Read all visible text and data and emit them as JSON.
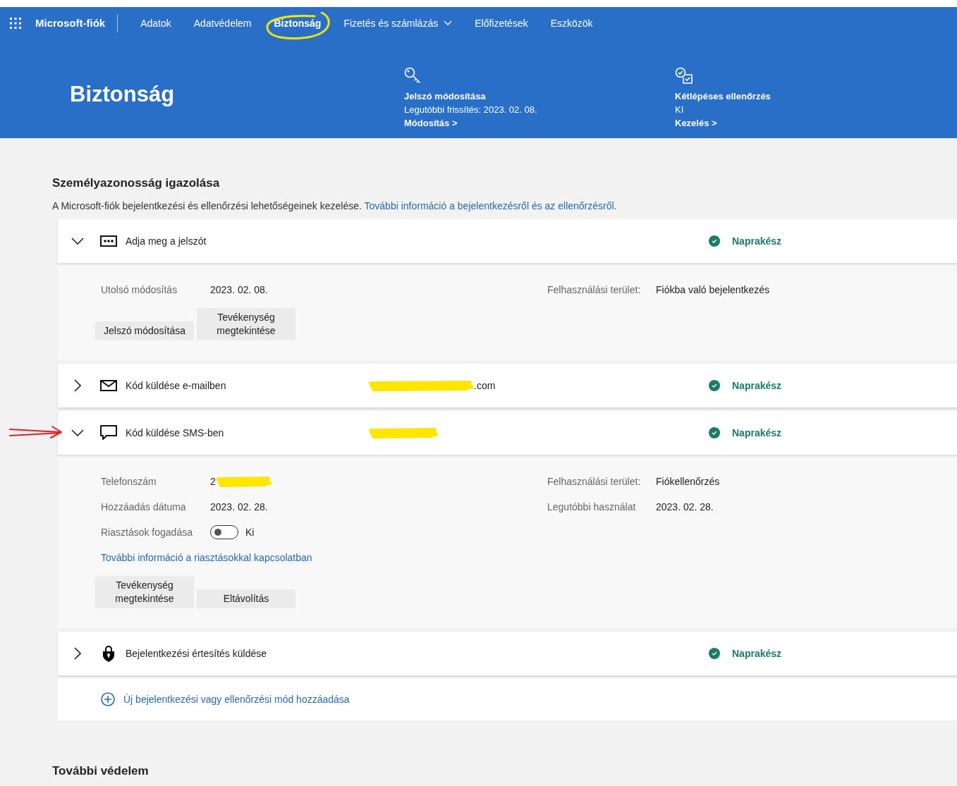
{
  "nav": {
    "brand": "Microsoft-fiók",
    "items": [
      {
        "label": "Adatok",
        "selected": false,
        "dropdown": false,
        "circled": false
      },
      {
        "label": "Adatvédelem",
        "selected": false,
        "dropdown": false,
        "circled": false
      },
      {
        "label": "Biztonság",
        "selected": true,
        "dropdown": false,
        "circled": true
      },
      {
        "label": "Fizetés és számlázás",
        "selected": false,
        "dropdown": true,
        "circled": false
      },
      {
        "label": "Előfizetések",
        "selected": false,
        "dropdown": false,
        "circled": false
      },
      {
        "label": "Eszközök",
        "selected": false,
        "dropdown": false,
        "circled": false
      }
    ]
  },
  "header": {
    "title": "Biztonság",
    "cards": [
      {
        "kind": "key",
        "title": "Jelszó módosítása",
        "status": "Legutóbbi frissítés: 2023. 02. 08.",
        "link": "Módosítás >"
      },
      {
        "kind": "checks",
        "title": "Kétlépéses ellenőrzés",
        "status": "KI",
        "link": "Kezelés >"
      }
    ]
  },
  "identity": {
    "title": "Személyazonosság igazolása",
    "description": "A Microsoft-fiók bejelentkezési és ellenőrzési lehetőségeinek kezelése.",
    "link": "További információ a bejelentkezésről és az ellenőrzésről.",
    "methods": [
      {
        "kind": "password",
        "label": "Adja meg a jelszót",
        "status": "Naprakész",
        "expanded": true,
        "arrow": false,
        "details": {
          "left": [
            {
              "kind": "text",
              "label": "Utolsó módosítás",
              "value": "2023. 02. 08.",
              "redacted": false
            }
          ],
          "right": [
            {
              "label": "Felhasználási terület:",
              "value": "Fiókba való bejelentkezés"
            }
          ],
          "buttons": [
            "Jelszó módosítása",
            "Tevékenység megtekintése"
          ]
        }
      },
      {
        "kind": "email",
        "label": "Kód küldése e-mailben",
        "value": ".com",
        "redacted": true,
        "status": "Naprakész",
        "expanded": false,
        "arrow": false
      },
      {
        "kind": "sms",
        "label": "Kód küldése SMS-ben",
        "redacted": true,
        "status": "Naprakész",
        "expanded": true,
        "arrow": true,
        "details": {
          "left": [
            {
              "kind": "text",
              "label": "Telefonszám",
              "value": "2",
              "redacted": true
            },
            {
              "kind": "text",
              "label": "Hozzáadás dátuma",
              "value": "2023. 02. 28.",
              "redacted": false
            },
            {
              "kind": "toggle",
              "label": "Riasztások fogadása",
              "value": "Ki",
              "on": false
            }
          ],
          "right": [
            {
              "label": "Felhasználási terület:",
              "value": "Fiókellenőrzés"
            },
            {
              "label": "Legutóbbi használat",
              "value": "2023. 02. 28."
            }
          ],
          "link": "További információ a riasztásokkal kapcsolatban",
          "buttons": [
            "Tevékenység megtekintése",
            "Eltávolítás"
          ]
        }
      },
      {
        "kind": "lock",
        "label": "Bejelentkezési értesítés küldése",
        "status": "Naprakész",
        "expanded": false,
        "arrow": false
      }
    ],
    "add_link": "Új bejelentkezési vagy ellenőrzési mód hozzáadása"
  },
  "more": {
    "title": "További védelem"
  }
}
